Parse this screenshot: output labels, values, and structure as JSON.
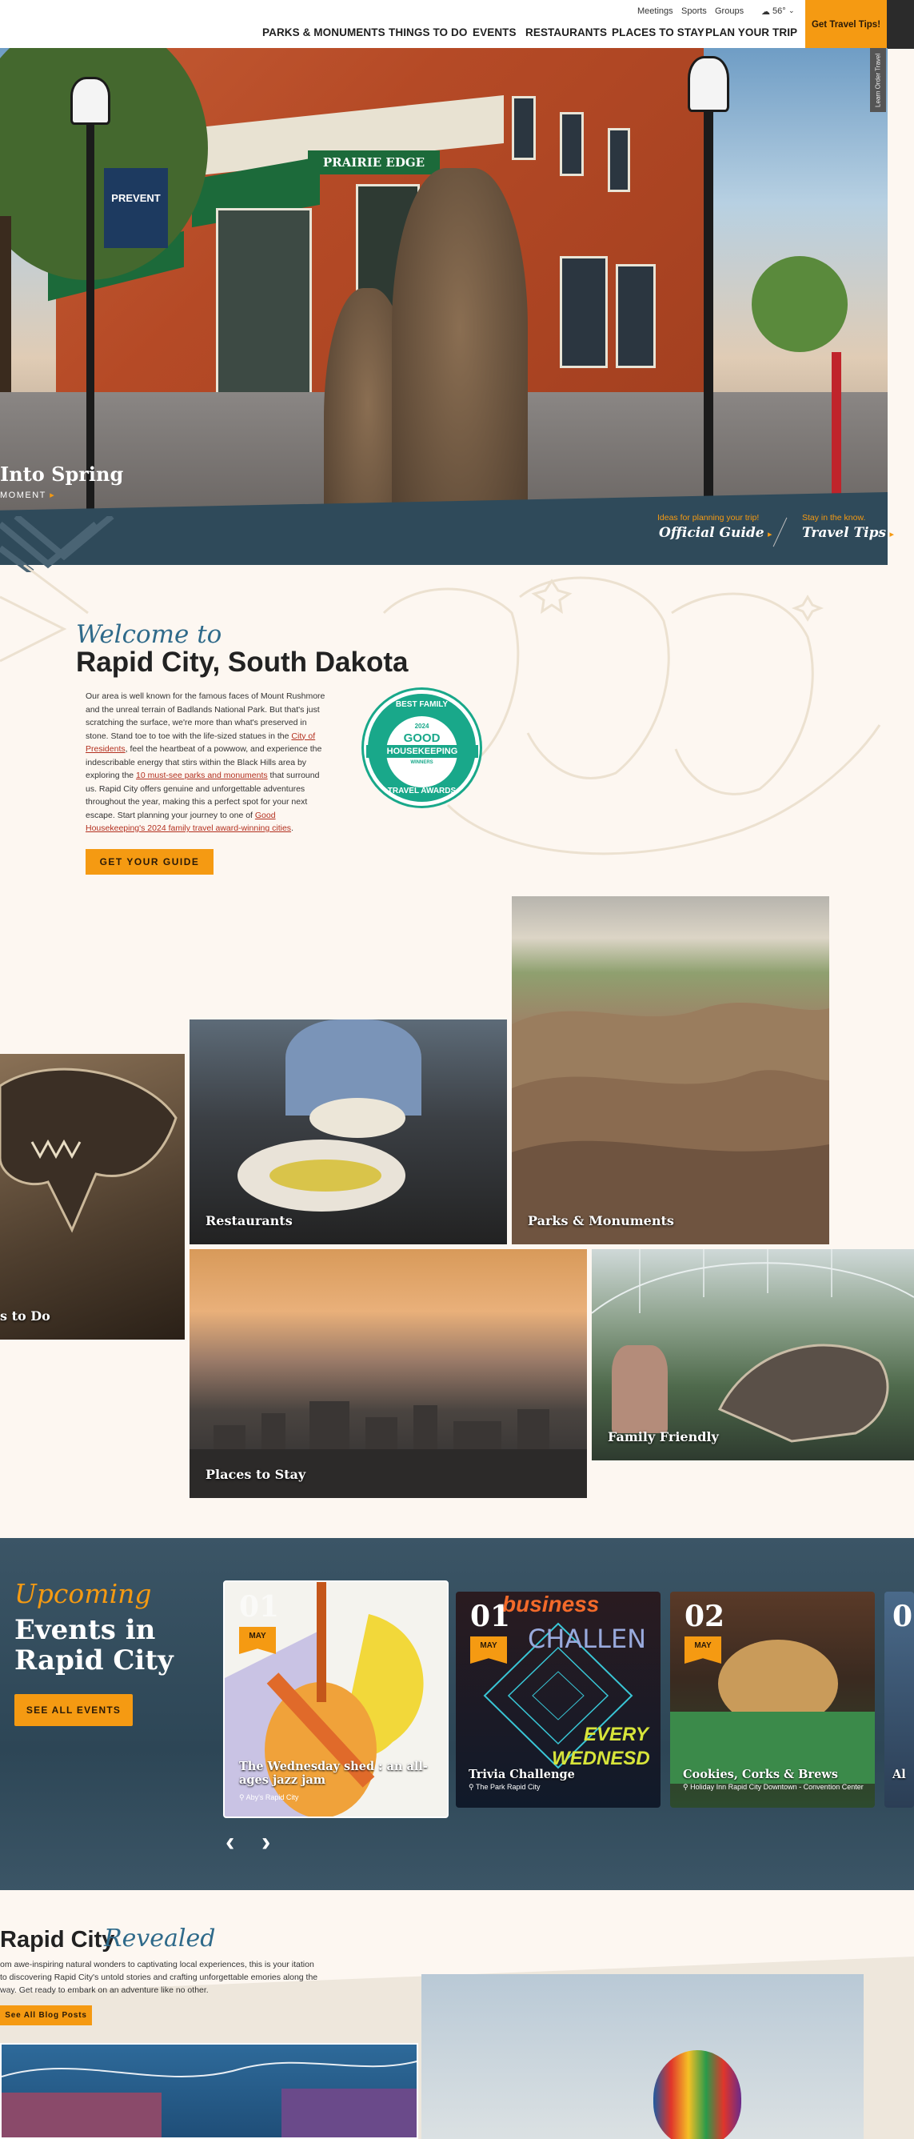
{
  "header": {
    "util": [
      "Meetings",
      "Sports",
      "Groups"
    ],
    "weather": "56°",
    "nav": [
      "PARKS & MONUMENTS",
      "THINGS TO DO",
      "EVENTS",
      "RESTAURANTS",
      "PLACES TO STAY",
      "PLAN YOUR TRIP"
    ],
    "cta": "Get Travel Tips!",
    "side_tab": "Learn Order Travel"
  },
  "hero": {
    "headline": "Into Spring",
    "more": "MOMENT",
    "storefront": "PRAIRIE EDGE",
    "banner": "PREVENT",
    "tip1_small": "Ideas for planning your trip!",
    "tip1_big": "Official Guide",
    "tip2_small": "Stay in the know.",
    "tip2_big": "Travel Tips"
  },
  "welcome": {
    "script": "Welcome to",
    "title": "Rapid City, South Dakota",
    "p1": "Our area is well known for the famous faces of Mount Rushmore and the unreal terrain of Badlands National Park. But that's just scratching the surface, we're more than what's preserved in stone. Stand toe to toe with the life-sized statues in the ",
    "link1": "City of Presidents",
    "p2": ", feel the heartbeat of a powwow, and experience the indescribable energy that stirs within the Black Hills area by exploring the ",
    "link2": "10 must-see parks and monuments",
    "p3": " that surround us. Rapid City offers genuine and unforgettable adventures throughout the year, making this a perfect spot for your next escape. Start planning your journey to one of ",
    "link3": "Good Housekeeping's 2024 family travel award-winning cities",
    "p4": ".",
    "button": "GET YOUR GUIDE",
    "badge": {
      "top": "BEST FAMILY",
      "year": "2024",
      "good": "GOOD",
      "hk": "HOUSEKEEPING",
      "win": "WINNERS",
      "bottom": "TRAVEL AWARDS"
    }
  },
  "tiles": [
    "s to Do",
    "Restaurants",
    "Parks & Monuments",
    "Places to Stay",
    "Family Friendly"
  ],
  "events": {
    "script": "Upcoming",
    "title": "Events in Rapid City",
    "button": "SEE ALL EVENTS",
    "cards": [
      {
        "day": "01",
        "month": "MAY",
        "title": "The Wednesday shed : an all-ages jazz jam",
        "loc": "Aby's Rapid City"
      },
      {
        "day": "01",
        "month": "MAY",
        "title": "Trivia Challenge",
        "loc": "The Park Rapid City",
        "art_a": "business",
        "art_b": "CHALLEN",
        "art_c": "EVERY",
        "art_d": "WEDNESD"
      },
      {
        "day": "02",
        "month": "MAY",
        "title": "Cookies, Corks & Brews",
        "loc": "Holiday Inn Rapid City Downtown - Convention Center"
      },
      {
        "day": "0",
        "month": "",
        "title": "Al",
        "loc": ""
      }
    ]
  },
  "revealed": {
    "title": "Rapid City",
    "script": "Revealed",
    "text": "om awe-inspiring natural wonders to captivating local experiences, this is your itation to discovering Rapid City's untold stories and crafting unforgettable emories along the way. Get ready to embark on an adventure like no other.",
    "button": "See All Blog Posts"
  }
}
